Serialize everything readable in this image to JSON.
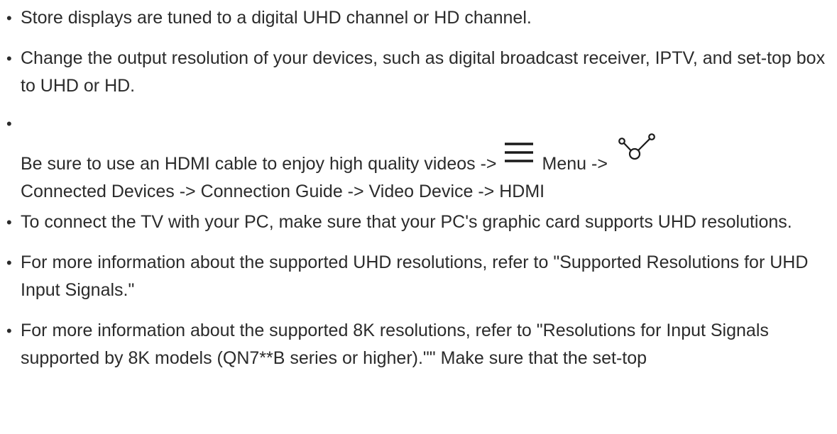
{
  "bullets": [
    {
      "text": "Store displays are tuned to a digital UHD channel or HD channel."
    },
    {
      "text": "Change the output resolution of your devices, such as digital broadcast receiver, IPTV, and set-top box to UHD or HD."
    },
    {
      "text_before": "Be sure to use an HDMI cable to enjoy high quality videos ->",
      "icon_1": "menu-lines-icon",
      "text_middle": "Menu ->",
      "icon_2": "connected-devices-icon",
      "text_after": "Connected Devices -> Connection Guide -> Video Device -> HDMI"
    },
    {
      "text": "To connect the TV with your PC, make sure that your PC's graphic card supports UHD resolutions."
    },
    {
      "text": "For more information about the supported UHD resolutions, refer to \"Supported Resolutions for UHD Input Signals.\""
    },
    {
      "text": "For more information about the supported 8K resolutions, refer to \"Resolutions for Input Signals supported by 8K models (QN7**B series or higher).\"\" Make sure that the set-top"
    }
  ],
  "bullet_glyph": "•",
  "colors": {
    "text": "#2b2b2b",
    "background": "#ffffff"
  }
}
